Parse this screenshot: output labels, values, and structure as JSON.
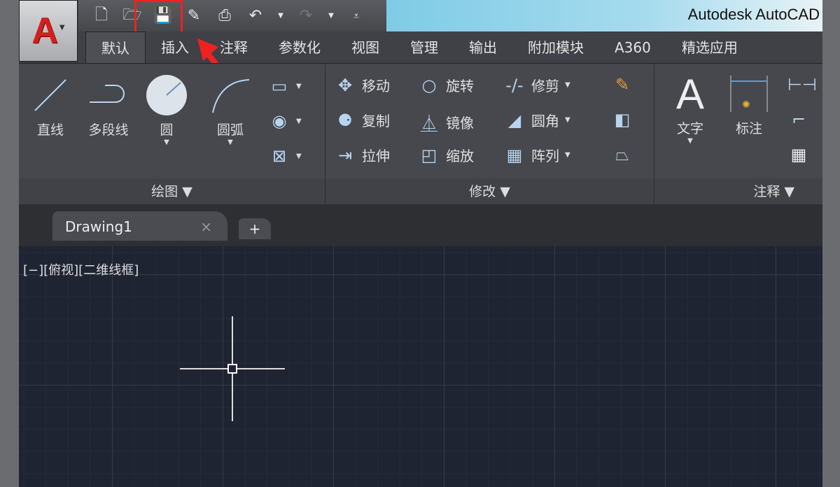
{
  "app": {
    "logo": "A",
    "title": "Autodesk AutoCAD"
  },
  "qat": [
    {
      "icon": "new-icon"
    },
    {
      "icon": "open-icon"
    },
    {
      "icon": "save-icon"
    },
    {
      "icon": "save-as-icon"
    },
    {
      "icon": "plot-icon"
    },
    {
      "icon": "undo-icon"
    },
    {
      "icon": "redo-icon"
    }
  ],
  "tabs": [
    "默认",
    "插入",
    "注释",
    "参数化",
    "视图",
    "管理",
    "输出",
    "附加模块",
    "A360",
    "精选应用"
  ],
  "draw": {
    "label": "绘图",
    "line": "直线",
    "pline": "多段线",
    "circle": "圆",
    "arc": "圆弧"
  },
  "modify": {
    "label": "修改",
    "move": "移动",
    "rotate": "旋转",
    "trim": "修剪",
    "copy": "复制",
    "mirror": "镜像",
    "fillet": "圆角",
    "stretch": "拉伸",
    "scale": "缩放",
    "array": "阵列"
  },
  "annotation": {
    "label": "注释",
    "text": "文字",
    "dim": "标注"
  },
  "doc": {
    "tab": "Drawing1",
    "close": "×",
    "add": "+"
  },
  "viewport": "[−][俯视][二维线框]",
  "colors": {
    "highlight": "#e22222",
    "canvas": "#1f2433"
  }
}
